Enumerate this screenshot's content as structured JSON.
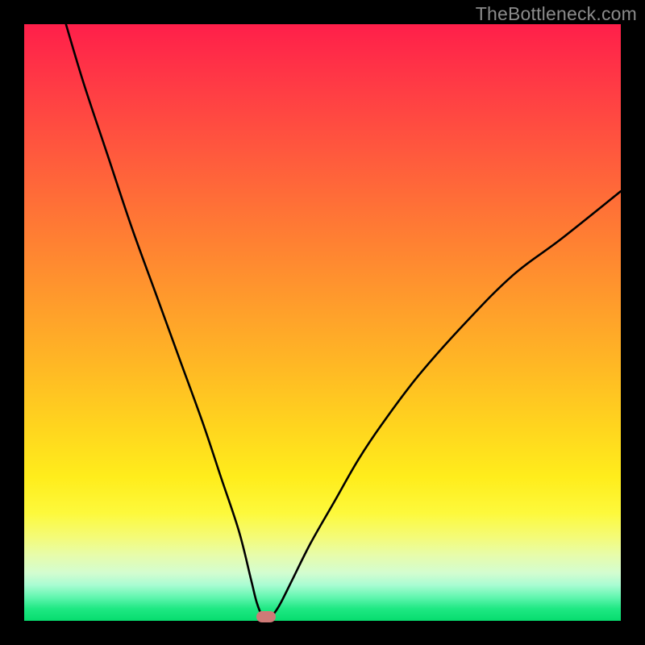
{
  "watermark": "TheBottleneck.com",
  "colors": {
    "frame": "#000000",
    "curve": "#000000",
    "marker": "#cf7a77"
  },
  "chart_data": {
    "type": "line",
    "title": "",
    "xlabel": "",
    "ylabel": "",
    "x_range": [
      0,
      100
    ],
    "y_range": [
      0,
      100
    ],
    "note": "Gradient background from red (top, high bottleneck) to green (bottom, no bottleneck). Black curve shows bottleneck % vs. an unlabeled x-axis; minimum near x≈40.",
    "series": [
      {
        "name": "bottleneck-curve",
        "x": [
          7,
          10,
          14,
          18,
          22,
          26,
          30,
          33,
          36,
          38,
          39,
          40,
          41,
          42,
          43,
          45,
          48,
          52,
          56,
          60,
          66,
          74,
          82,
          90,
          100
        ],
        "values": [
          100,
          90,
          78,
          66,
          55,
          44,
          33,
          24,
          15,
          7,
          3,
          0.7,
          0.5,
          1.4,
          3,
          7,
          13,
          20,
          27,
          33,
          41,
          50,
          58,
          64,
          72
        ]
      }
    ],
    "marker": {
      "x": 40.5,
      "y": 0.7
    }
  }
}
